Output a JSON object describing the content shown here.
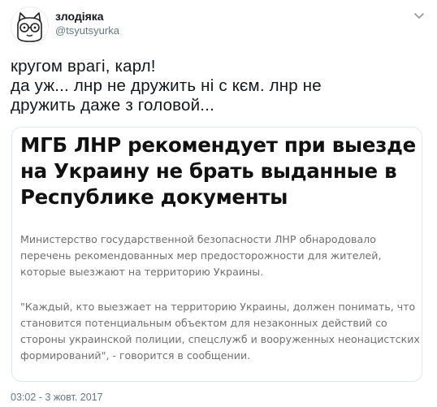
{
  "author": {
    "name": "злодіяка",
    "handle": "@tsyutsyurka",
    "avatar_icon": "cat-face-icon",
    "menu_icon": "chevron-down-icon"
  },
  "tweet": {
    "text_lines": [
      "кругом врагі, карл!",
      "да уж... лнр не дружить ні с кєм. лнр не",
      "дружить даже з головой..."
    ]
  },
  "card": {
    "headline_lines": [
      "МГБ ЛНР рекомендует при выезде",
      "на Украину не брать выданные в",
      "Республике документы"
    ],
    "paragraph1_lines": [
      "Министерство государственной безопасности ЛНР обнародовало",
      "перечень рекомендованных мер предосторожности для жителей,",
      "которые выезжают на территорию Украины."
    ],
    "paragraph2_lines": [
      "\"Каждый, кто выезжает на территорию Украины, должен понимать, что",
      "становится потенциальным объектом для незаконных действий со",
      "стороны украинской полиции, спецслужб и вооруженных неонацистских",
      "формирований\", - говорится в сообщении."
    ]
  },
  "timestamp": "03:02 - 3 жовт. 2017",
  "colors": {
    "text": "#14171a",
    "secondary": "#657786",
    "card_border": "#e1e8ed",
    "card_body": "#6f6f6f"
  }
}
